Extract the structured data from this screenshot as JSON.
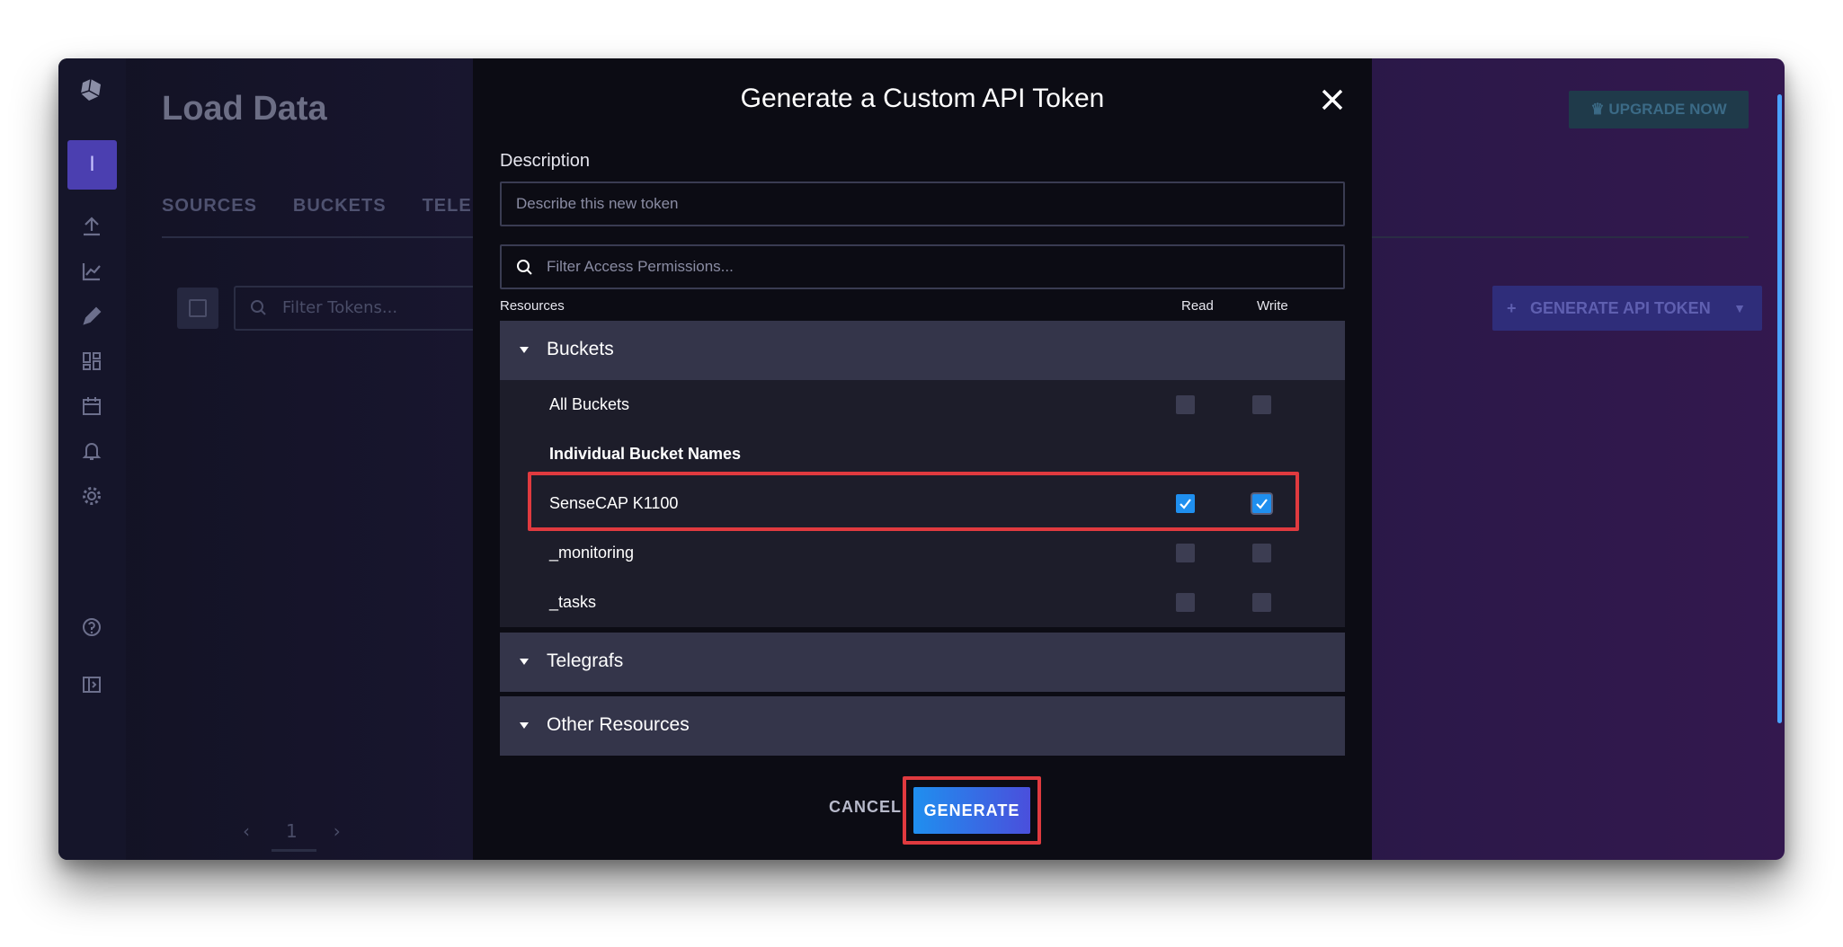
{
  "background": {
    "page_title": "Load Data",
    "upgrade_button": "UPGRADE NOW",
    "tabs": [
      "SOURCES",
      "BUCKETS",
      "TELE"
    ],
    "filter_tokens_placeholder": "Filter Tokens...",
    "generate_api_token_button": "GENERATE API TOKEN",
    "org_initial": "I",
    "pager": {
      "prev": "‹",
      "page": "1",
      "next": "›"
    }
  },
  "modal": {
    "title": "Generate a Custom API Token",
    "description_label": "Description",
    "description_placeholder": "Describe this new token",
    "filter_placeholder": "Filter Access Permissions...",
    "columns": {
      "resources": "Resources",
      "read": "Read",
      "write": "Write"
    },
    "groups": [
      {
        "label": "Buckets",
        "expanded": true,
        "rows": [
          {
            "label": "All Buckets",
            "read": false,
            "write": false
          },
          {
            "label": "Individual Bucket Names",
            "is_heading": true
          },
          {
            "label": "SenseCAP K1100",
            "read": true,
            "write": true
          },
          {
            "label": "_monitoring",
            "read": false,
            "write": false
          },
          {
            "label": "_tasks",
            "read": false,
            "write": false
          }
        ]
      },
      {
        "label": "Telegrafs",
        "expanded": false
      },
      {
        "label": "Other Resources",
        "expanded": false
      }
    ],
    "cancel_label": "CANCEL",
    "generate_label": "GENERATE"
  },
  "colors": {
    "accent": "#1f8fef",
    "highlight": "#e03a3f",
    "modal_bg": "#0c0c14",
    "group_header": "#34354a"
  }
}
